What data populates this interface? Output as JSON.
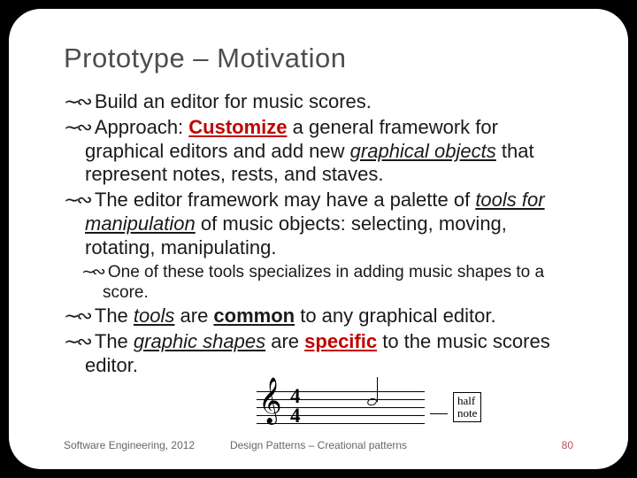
{
  "title": "Prototype – Motivation",
  "bullets": {
    "b1_1": "Build an editor for music scores.",
    "b1_2a": "Approach: ",
    "b1_2b": "Customize",
    "b1_2c": " a general framework for graphical editors and add new ",
    "b1_2d": "graphical objects",
    "b1_2e": " that represent notes, rests, and staves.",
    "b1_3a": "The editor framework may have a palette of ",
    "b1_3b": "tools for manipulation",
    "b1_3c": " of music objects: selecting, moving, rotating, manipulating.",
    "b2_1": "One of these tools specializes in adding music shapes to a score.",
    "b1_4a": "The ",
    "b1_4b": "tools",
    "b1_4c": " are ",
    "b1_4d": "common",
    "b1_4e": " to any graphical editor.",
    "b1_5a": "The ",
    "b1_5b": "graphic shapes",
    "b1_5c": " are ",
    "b1_5d": "specific",
    "b1_5e": " to the music scores editor."
  },
  "staff": {
    "ts_top": "4",
    "ts_bot": "4",
    "callout_l1": "half",
    "callout_l2": "note"
  },
  "footer": {
    "left": "Software Engineering, 2012",
    "center": "Design Patterns – Creational patterns",
    "page": "80"
  },
  "bullet_glyph": "∼∾"
}
